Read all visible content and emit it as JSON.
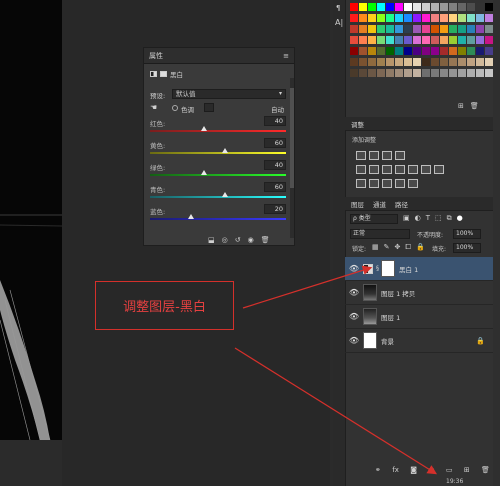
{
  "properties_panel": {
    "title": "属性",
    "subtitle": "黑白",
    "preset_label": "预设:",
    "preset_value": "默认值",
    "tint_label": "色调",
    "auto_button": "自动",
    "sliders": [
      {
        "label": "红色:",
        "value": "40",
        "level": 0.4,
        "gradient": "linear-gradient(90deg,#7a1e1e,#ff2a2a)"
      },
      {
        "label": "黄色:",
        "value": "60",
        "level": 0.55,
        "gradient": "linear-gradient(90deg,#6a6a12,#ffff2a)"
      },
      {
        "label": "绿色:",
        "value": "40",
        "level": 0.4,
        "gradient": "linear-gradient(90deg,#145e14,#2aff2a)"
      },
      {
        "label": "青色:",
        "value": "60",
        "level": 0.55,
        "gradient": "linear-gradient(90deg,#1a5e64,#2affff)"
      },
      {
        "label": "蓝色:",
        "value": "20",
        "level": 0.3,
        "gradient": "linear-gradient(90deg,#1a1a70,#3a3aff)"
      }
    ]
  },
  "adjustments_panel": {
    "tab": "调整",
    "add_label": "添加调整"
  },
  "layers_panel": {
    "tabs": [
      "图层",
      "通道",
      "路径"
    ],
    "filter_kind": "ρ 类型",
    "blend_mode": "正常",
    "opacity_label": "不透明度:",
    "opacity_value": "100%",
    "lock_label": "锁定:",
    "fill_label": "填充:",
    "fill_value": "100%",
    "layers": [
      {
        "name": "黑白 1",
        "visible": true,
        "selected": true
      },
      {
        "name": "图层 1 拷贝",
        "visible": true,
        "selected": false
      },
      {
        "name": "图层 1",
        "visible": true,
        "selected": false
      },
      {
        "name": "背景",
        "visible": true,
        "selected": false,
        "locked": true
      }
    ]
  },
  "annotation": {
    "text": "调整图层-黑白",
    "color": "#d4302b"
  },
  "status": {
    "time": "19:36"
  },
  "colors": {
    "accent_selected_layer": "#3a5370",
    "annotation_red": "#d4302b"
  }
}
